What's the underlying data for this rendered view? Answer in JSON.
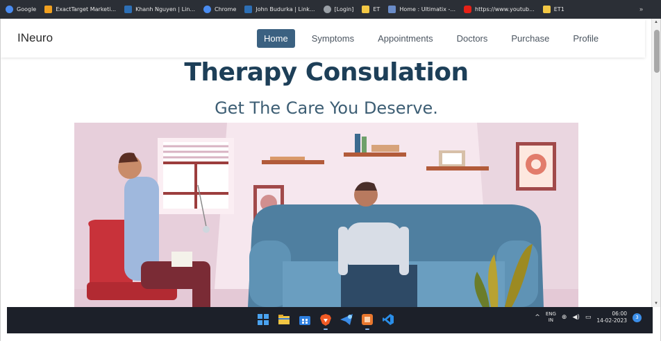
{
  "bookmarks": [
    {
      "label": "Google",
      "icon": "google-icon",
      "color": "#4a8cf0"
    },
    {
      "label": "ExactTarget Marketi...",
      "icon": "exacttarget-icon",
      "color": "#f0a020"
    },
    {
      "label": "Khanh Nguyen | Lin...",
      "icon": "linkedin-icon",
      "color": "#2d6fb5"
    },
    {
      "label": "Chrome",
      "icon": "chrome-icon",
      "color": "#4a8cf0"
    },
    {
      "label": "John Budurka | Link...",
      "icon": "linkedin-icon",
      "color": "#2d6fb5"
    },
    {
      "label": "[Login]",
      "icon": "globe-icon",
      "color": "#9aa0a6"
    },
    {
      "label": "ET",
      "icon": "folder-icon",
      "color": "#f2c744"
    },
    {
      "label": "Home : Ultimatix -...",
      "icon": "ultimatix-icon",
      "color": "#6a8cc8"
    },
    {
      "label": "https://www.youtub...",
      "icon": "youtube-icon",
      "color": "#e62117"
    },
    {
      "label": "ET1",
      "icon": "folder-icon",
      "color": "#f2c744"
    }
  ],
  "bookmarks_more": "»",
  "site": {
    "brand": "INeuro",
    "nav": [
      {
        "label": "Home",
        "active": true
      },
      {
        "label": "Symptoms",
        "active": false
      },
      {
        "label": "Appointments",
        "active": false
      },
      {
        "label": "Doctors",
        "active": false
      },
      {
        "label": "Purchase",
        "active": false
      },
      {
        "label": "Profile",
        "active": false
      }
    ],
    "title": "Therapy Consulation",
    "subtitle": "Get The Care You Deserve."
  },
  "taskbar": {
    "apps": [
      "windows-start-icon",
      "file-explorer-icon",
      "store-icon",
      "brave-icon",
      "mail-icon",
      "office-icon",
      "vscode-icon"
    ],
    "language_top": "ENG",
    "language_bottom": "IN",
    "time": "06:00",
    "date": "14-02-2023",
    "notifications": "3"
  },
  "colors": {
    "nav_active": "#3b6181",
    "heading": "#1d3f58",
    "taskbar": "#1c2029",
    "bookmarks_bar": "#2b2f36"
  }
}
